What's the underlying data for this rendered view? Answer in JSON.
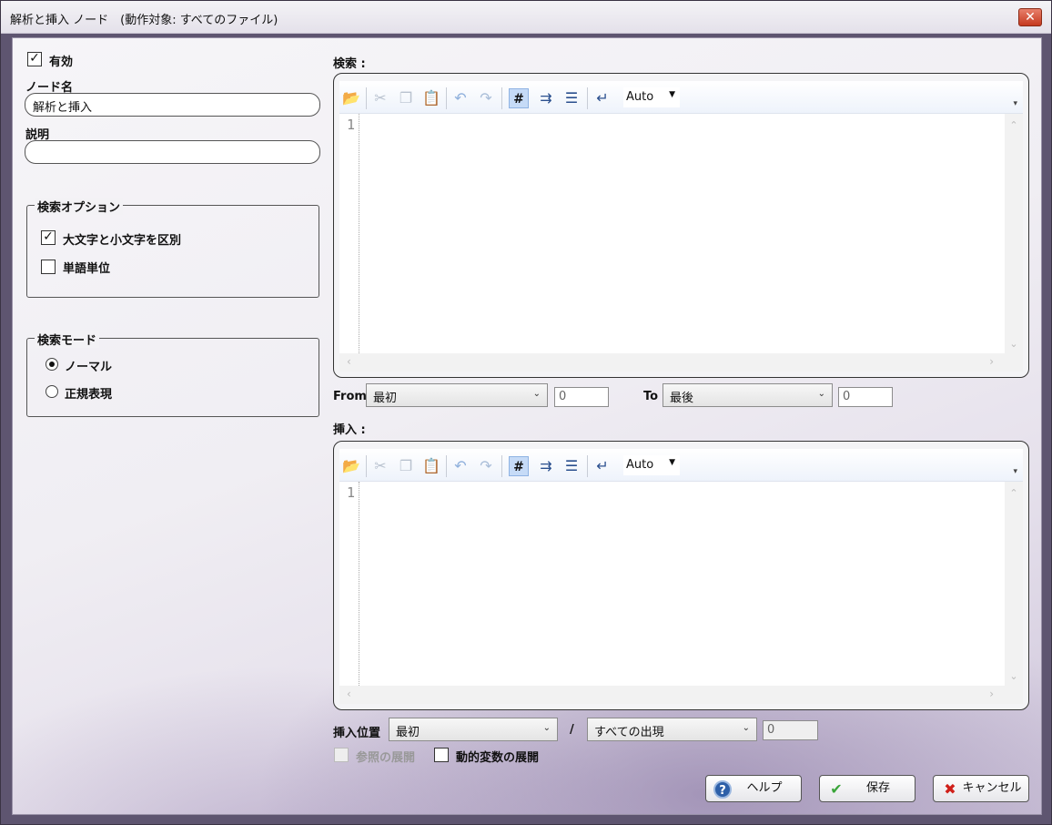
{
  "window": {
    "title": "解析と挿入 ノード　(動作対象: すべてのファイル)",
    "close_icon": "close-icon"
  },
  "left": {
    "enabled_label": "有効",
    "enabled_checked": true,
    "node_name_label": "ノード名",
    "node_name_value": "解析と挿入",
    "description_label": "説明",
    "description_value": "",
    "search_options": {
      "title": "検索オプション",
      "case_sensitive_label": "大文字と小文字を区別",
      "case_sensitive_checked": true,
      "whole_word_label": "単語単位",
      "whole_word_checked": false
    },
    "search_mode": {
      "title": "検索モード",
      "normal_label": "ノーマル",
      "regex_label": "正規表現",
      "selected": "normal"
    }
  },
  "search_editor": {
    "label": "検索 :",
    "line_number": "1",
    "encoding": "Auto",
    "hash_label": "#"
  },
  "range": {
    "from_label": "From",
    "from_value": "最初",
    "from_number": "0",
    "to_label": "To",
    "to_value": "最後",
    "to_number": "0"
  },
  "insert_editor": {
    "label": "挿入 :",
    "line_number": "1",
    "encoding": "Auto",
    "hash_label": "#"
  },
  "insert_position": {
    "label": "挿入位置",
    "position_value": "最初",
    "separator": "/",
    "occurrence_value": "すべての出現",
    "occurrence_number": "0"
  },
  "expand": {
    "reference_label": "参照の展開",
    "reference_checked": false,
    "dynamic_label": "動的変数の展開",
    "dynamic_checked": false
  },
  "buttons": {
    "help_label": "ヘルプ",
    "save_label": "保存",
    "cancel_label": "キャンセル"
  }
}
